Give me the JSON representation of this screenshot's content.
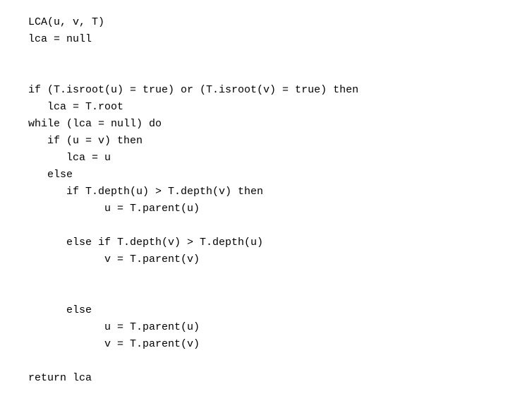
{
  "code": {
    "lines": [
      "LCA(u, v, T)",
      "lca = null",
      "",
      "",
      "if (T.isroot(u) = true) or (T.isroot(v) = true) then",
      "   lca = T.root",
      "while (lca = null) do",
      "   if (u = v) then",
      "      lca = u",
      "   else",
      "      if T.depth(u) > T.depth(v) then",
      "            u = T.parent(u)",
      "",
      "      else if T.depth(v) > T.depth(u)",
      "            v = T.parent(v)",
      "",
      "",
      "      else",
      "            u = T.parent(u)",
      "            v = T.parent(v)",
      "",
      "return lca"
    ]
  }
}
